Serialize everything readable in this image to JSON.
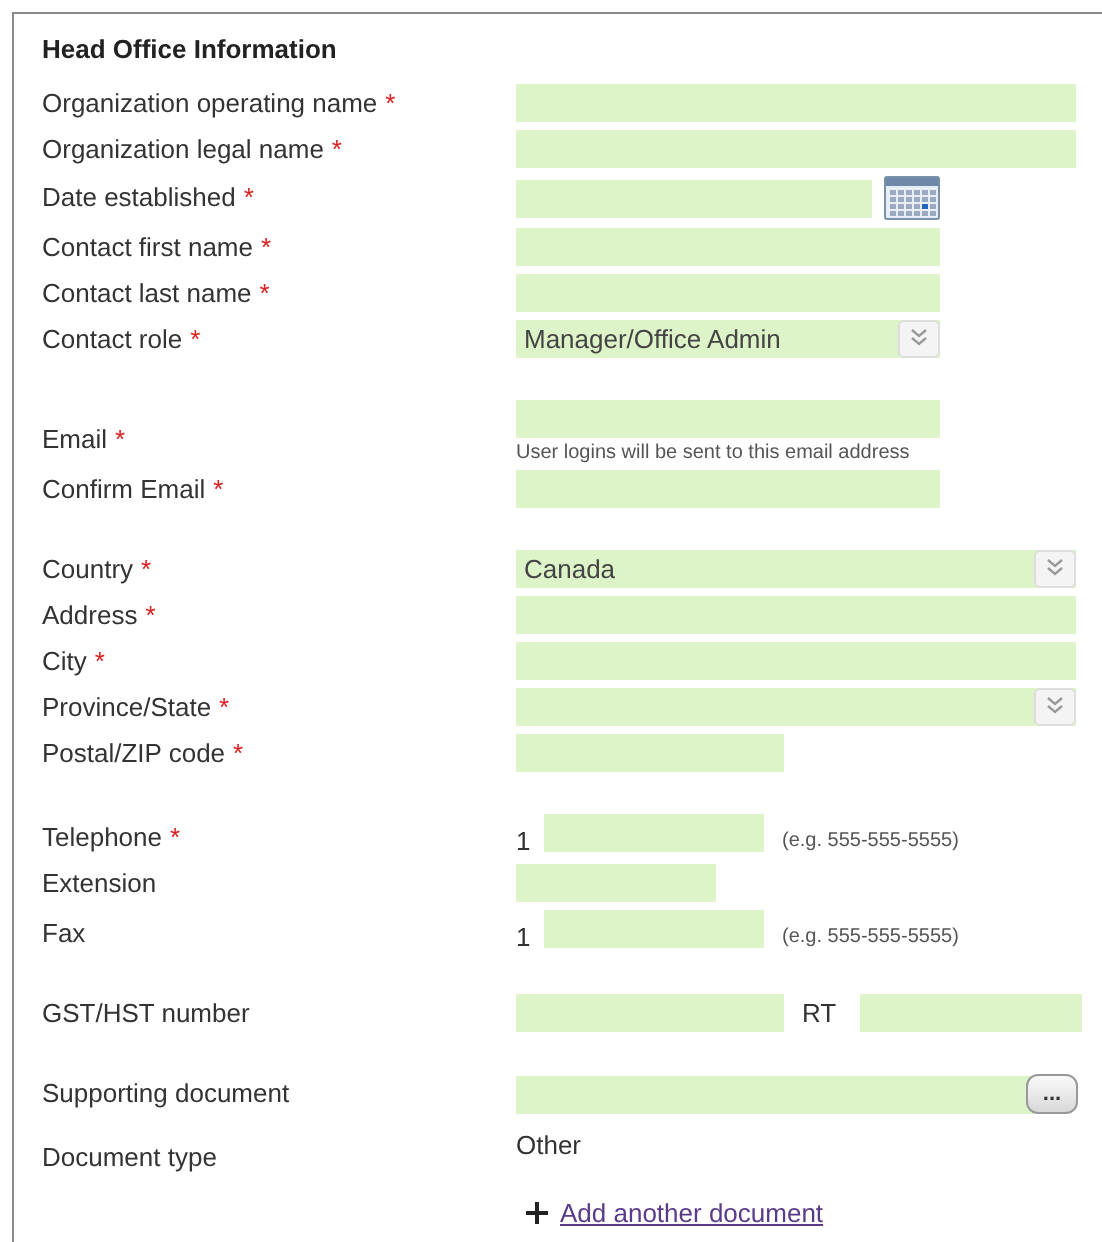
{
  "title": "Head Office Information",
  "sections": [
    [
      {
        "label": "Organization operating name",
        "mark": "*",
        "kind": "wide-text"
      },
      {
        "label": "Organization legal name",
        "mark": "*",
        "kind": "wide-text"
      },
      {
        "label": "Date established",
        "mark": "*",
        "kind": "date"
      },
      {
        "label": "Contact first name",
        "mark": "*",
        "kind": "text"
      },
      {
        "label": "Contact last name",
        "mark": "*",
        "kind": "text"
      },
      {
        "label": "Contact role",
        "mark": "*",
        "kind": "select",
        "value": "Manager/Office Admin"
      }
    ],
    [
      {
        "label": "Email",
        "mark": "*",
        "kind": "email",
        "help": "User logins will be sent to this email address"
      },
      {
        "label": "Confirm Email",
        "mark": "*",
        "kind": "text"
      }
    ],
    [
      {
        "label": "Country",
        "mark": "*",
        "kind": "wide-select",
        "value": "Canada"
      },
      {
        "label": "Address",
        "mark": "*",
        "kind": "wide-text"
      },
      {
        "label": "City",
        "mark": "*",
        "kind": "wide-text"
      },
      {
        "label": "Province/State",
        "mark": "*",
        "kind": "wide-select"
      },
      {
        "label": "Postal/ZIP code",
        "mark": "*",
        "kind": "short-text"
      }
    ],
    [
      {
        "label": "Telephone",
        "mark": "*",
        "kind": "phone",
        "prefix": "1",
        "hint": "(e.g. 555-555-5555)"
      },
      {
        "label": "Extension",
        "kind": "small-text"
      },
      {
        "label": "Fax",
        "kind": "phone",
        "prefix": "1",
        "hint": "(e.g. 555-555-5555)"
      }
    ],
    [
      {
        "label": "GST/HST number",
        "kind": "gst",
        "middle": "RT"
      }
    ],
    [
      {
        "label": "Supporting document",
        "kind": "file",
        "button": "..."
      },
      {
        "label": "Document type",
        "kind": "static",
        "value": "Other"
      }
    ]
  ],
  "add_link": "Add another document"
}
